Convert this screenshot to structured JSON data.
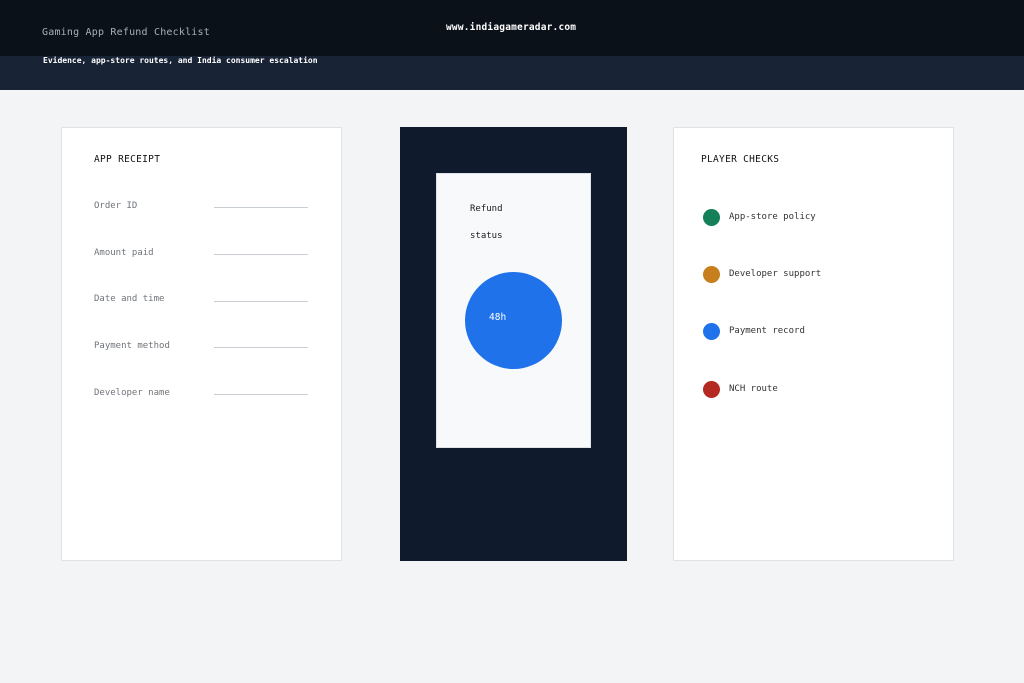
{
  "header": {
    "title": "Gaming App Refund Checklist",
    "site": "www.indiagameradar.com",
    "subtitle": "Evidence, app-store routes, and India consumer escalation"
  },
  "receipt": {
    "heading": "APP RECEIPT",
    "fields": [
      {
        "label": "Order ID"
      },
      {
        "label": "Amount paid"
      },
      {
        "label": "Date and time"
      },
      {
        "label": "Payment method"
      },
      {
        "label": "Developer name"
      }
    ]
  },
  "phone": {
    "status_line1": "Refund",
    "status_line2": "status",
    "status_value": "48h",
    "status_color": "#1f72ea"
  },
  "checks": {
    "heading": "PLAYER CHECKS",
    "items": [
      {
        "label": "App-store policy",
        "color": "#14805a"
      },
      {
        "label": "Developer support",
        "color": "#c77e1c"
      },
      {
        "label": "Payment record",
        "color": "#1f72ea"
      },
      {
        "label": "NCH route",
        "color": "#b42a22"
      }
    ]
  }
}
